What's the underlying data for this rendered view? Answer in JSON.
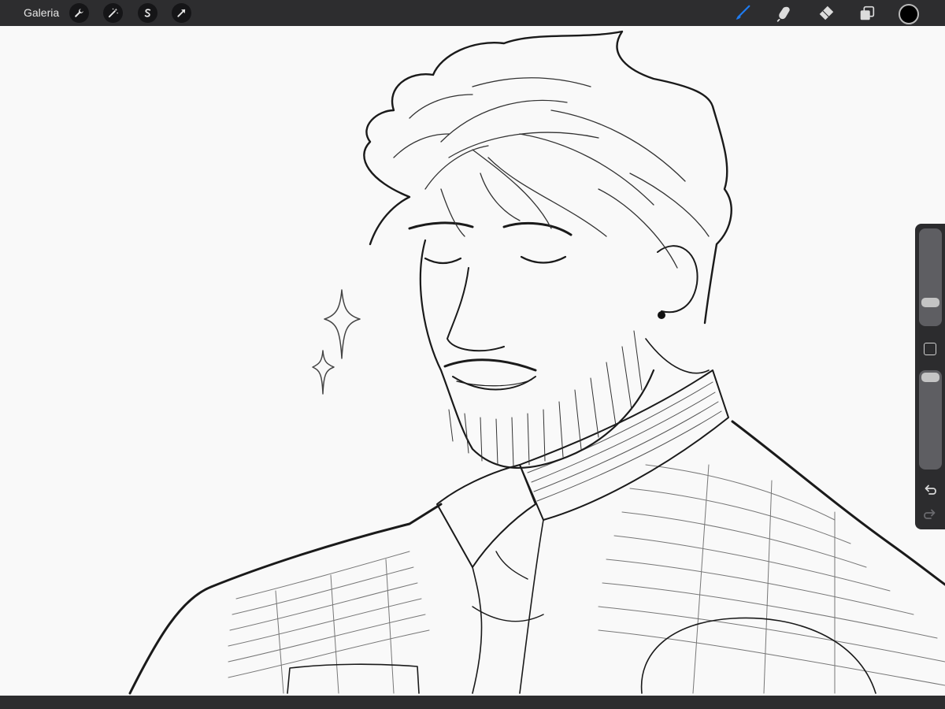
{
  "toolbar": {
    "gallery_label": "Galeria",
    "left_tools": [
      "wrench-icon",
      "magic-wand-icon",
      "selection-s-icon",
      "move-arrow-icon"
    ],
    "right_tools": [
      "brush-icon",
      "smudge-icon",
      "eraser-icon",
      "layers-icon",
      "color-swatch"
    ],
    "active_tool": "brush",
    "active_color": "#000000",
    "brush_accent_color": "#1e7bf0"
  },
  "sidebar": {
    "brush_size": 0.33,
    "opacity": 0.97,
    "buttons": [
      "modify-button",
      "undo-icon",
      "redo-icon"
    ]
  },
  "canvas": {
    "content": "line-art-portrait"
  }
}
